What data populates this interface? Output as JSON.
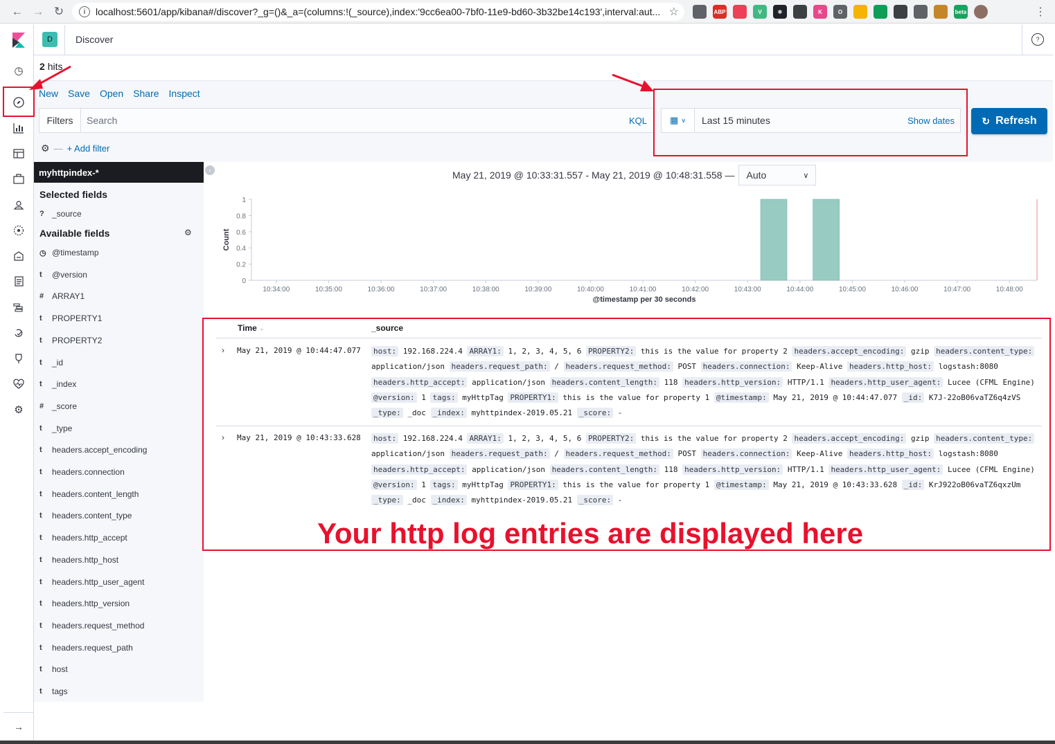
{
  "browser": {
    "url": "localhost:5601/app/kibana#/discover?_g=()&_a=(columns:!(_source),index:'9cc6ea00-7bf0-11e9-bd60-3b32be14c193',interval:aut...",
    "extensions": [
      {
        "name": "drive-icon",
        "color": "#5f6368",
        "label": ""
      },
      {
        "name": "adblock-icon",
        "color": "#d93025",
        "label": "ABP"
      },
      {
        "name": "pocket-icon",
        "color": "#ef3f56",
        "label": ""
      },
      {
        "name": "vue-icon",
        "color": "#41b883",
        "label": "V"
      },
      {
        "name": "react-icon",
        "color": "#20232a",
        "label": "⚛"
      },
      {
        "name": "extension-icon",
        "color": "#3c4043",
        "label": ""
      },
      {
        "name": "kibana-ext-icon",
        "color": "#e8478b",
        "label": "K"
      },
      {
        "name": "circle-ext-icon",
        "color": "#5f6368",
        "label": "O"
      },
      {
        "name": "color-ext-icon",
        "color": "#f4b400",
        "label": ""
      },
      {
        "name": "leaf-ext-icon",
        "color": "#0f9d58",
        "label": ""
      },
      {
        "name": "window-ext-icon",
        "color": "#3c4043",
        "label": ""
      },
      {
        "name": "dots-ext-icon",
        "color": "#5f6368",
        "label": ""
      },
      {
        "name": "cookie-ext-icon",
        "color": "#c5862b",
        "label": ""
      },
      {
        "name": "beta-ext-icon",
        "color": "#1aa260",
        "label": "beta"
      },
      {
        "name": "profile-avatar-icon",
        "color": "#8d6e63",
        "label": ""
      }
    ]
  },
  "header": {
    "space_initial": "D",
    "title": "Discover"
  },
  "hits": {
    "count": "2",
    "label": "hits"
  },
  "top_menu": [
    "New",
    "Save",
    "Open",
    "Share",
    "Inspect"
  ],
  "query_bar": {
    "filters_label": "Filters",
    "search_placeholder": "Search",
    "language": "KQL",
    "date_label": "Last 15 minutes",
    "show_dates": "Show dates",
    "refresh_label": "Refresh",
    "add_filter": "+ Add filter"
  },
  "sidebar": {
    "index_pattern": "myhttpindex-*",
    "selected_title": "Selected fields",
    "selected_fields": [
      {
        "type": "?",
        "name": "_source"
      }
    ],
    "available_title": "Available fields",
    "available_fields": [
      {
        "type": "◷",
        "name": "@timestamp"
      },
      {
        "type": "t",
        "name": "@version"
      },
      {
        "type": "#",
        "name": "ARRAY1"
      },
      {
        "type": "t",
        "name": "PROPERTY1"
      },
      {
        "type": "t",
        "name": "PROPERTY2"
      },
      {
        "type": "t",
        "name": "_id"
      },
      {
        "type": "t",
        "name": "_index"
      },
      {
        "type": "#",
        "name": "_score"
      },
      {
        "type": "t",
        "name": "_type"
      },
      {
        "type": "t",
        "name": "headers.accept_encoding"
      },
      {
        "type": "t",
        "name": "headers.connection"
      },
      {
        "type": "t",
        "name": "headers.content_length"
      },
      {
        "type": "t",
        "name": "headers.content_type"
      },
      {
        "type": "t",
        "name": "headers.http_accept"
      },
      {
        "type": "t",
        "name": "headers.http_host"
      },
      {
        "type": "t",
        "name": "headers.http_user_agent"
      },
      {
        "type": "t",
        "name": "headers.http_version"
      },
      {
        "type": "t",
        "name": "headers.request_method"
      },
      {
        "type": "t",
        "name": "headers.request_path"
      },
      {
        "type": "t",
        "name": "host"
      },
      {
        "type": "t",
        "name": "tags"
      }
    ]
  },
  "chart_header": {
    "range": "May 21, 2019 @ 10:33:31.557 - May 21, 2019 @ 10:48:31.558 —",
    "interval": "Auto"
  },
  "chart_data": {
    "type": "bar",
    "xlabel": "@timestamp per 30 seconds",
    "ylabel": "Count",
    "ylim": [
      0,
      1
    ],
    "yticks": [
      "0",
      "0.2",
      "0.4",
      "0.6",
      "0.8",
      "1"
    ],
    "xticks": [
      "10:34:00",
      "10:35:00",
      "10:36:00",
      "10:37:00",
      "10:38:00",
      "10:39:00",
      "10:40:00",
      "10:41:00",
      "10:42:00",
      "10:43:00",
      "10:44:00",
      "10:45:00",
      "10:46:00",
      "10:47:00",
      "10:48:00"
    ],
    "bars": [
      {
        "x": "10:43:30",
        "value": 1
      },
      {
        "x": "10:44:30",
        "value": 1
      }
    ],
    "bar_color": "#98ccc2"
  },
  "table": {
    "col_time": "Time",
    "col_source": "_source",
    "rows": [
      {
        "time": "May 21, 2019 @ 10:44:47.077",
        "fields": [
          [
            "host:",
            "192.168.224.4"
          ],
          [
            "ARRAY1:",
            "1, 2, 3, 4, 5, 6"
          ],
          [
            "PROPERTY2:",
            "this is the value for property 2"
          ],
          [
            "headers.accept_encoding:",
            "gzip"
          ],
          [
            "headers.content_type:",
            "application/json"
          ],
          [
            "headers.request_path:",
            "/"
          ],
          [
            "headers.request_method:",
            "POST"
          ],
          [
            "headers.connection:",
            "Keep-Alive"
          ],
          [
            "headers.http_host:",
            "logstash:8080"
          ],
          [
            "headers.http_accept:",
            "application/json"
          ],
          [
            "headers.content_length:",
            "118"
          ],
          [
            "headers.http_version:",
            "HTTP/1.1"
          ],
          [
            "headers.http_user_agent:",
            "Lucee (CFML Engine)"
          ],
          [
            "@version:",
            "1"
          ],
          [
            "tags:",
            "myHttpTag"
          ],
          [
            "PROPERTY1:",
            "this is the value for property 1"
          ],
          [
            "@timestamp:",
            "May 21, 2019 @ 10:44:47.077"
          ],
          [
            "_id:",
            "K7J-22oB06vaTZ6q4zVS"
          ],
          [
            "_type:",
            "_doc"
          ],
          [
            "_index:",
            "myhttpindex-2019.05.21"
          ],
          [
            "_score:",
            "-"
          ]
        ]
      },
      {
        "time": "May 21, 2019 @ 10:43:33.628",
        "fields": [
          [
            "host:",
            "192.168.224.4"
          ],
          [
            "ARRAY1:",
            "1, 2, 3, 4, 5, 6"
          ],
          [
            "PROPERTY2:",
            "this is the value for property 2"
          ],
          [
            "headers.accept_encoding:",
            "gzip"
          ],
          [
            "headers.content_type:",
            "application/json"
          ],
          [
            "headers.request_path:",
            "/"
          ],
          [
            "headers.request_method:",
            "POST"
          ],
          [
            "headers.connection:",
            "Keep-Alive"
          ],
          [
            "headers.http_host:",
            "logstash:8080"
          ],
          [
            "headers.http_accept:",
            "application/json"
          ],
          [
            "headers.content_length:",
            "118"
          ],
          [
            "headers.http_version:",
            "HTTP/1.1"
          ],
          [
            "headers.http_user_agent:",
            "Lucee (CFML Engine)"
          ],
          [
            "@version:",
            "1"
          ],
          [
            "tags:",
            "myHttpTag"
          ],
          [
            "PROPERTY1:",
            "this is the value for property 1"
          ],
          [
            "@timestamp:",
            "May 21, 2019 @ 10:43:33.628"
          ],
          [
            "_id:",
            "KrJ922oB06vaTZ6qxzUm"
          ],
          [
            "_type:",
            "_doc"
          ],
          [
            "_index:",
            "myhttpindex-2019.05.21"
          ],
          [
            "_score:",
            "-"
          ]
        ]
      }
    ]
  },
  "annotation": {
    "caption": "Your http log entries are displayed here",
    "color": "#e8112d"
  },
  "colors": {
    "accent": "#006bb4",
    "nav_dark": "#1a1c21",
    "space_avatar": "#3dbdb1"
  }
}
